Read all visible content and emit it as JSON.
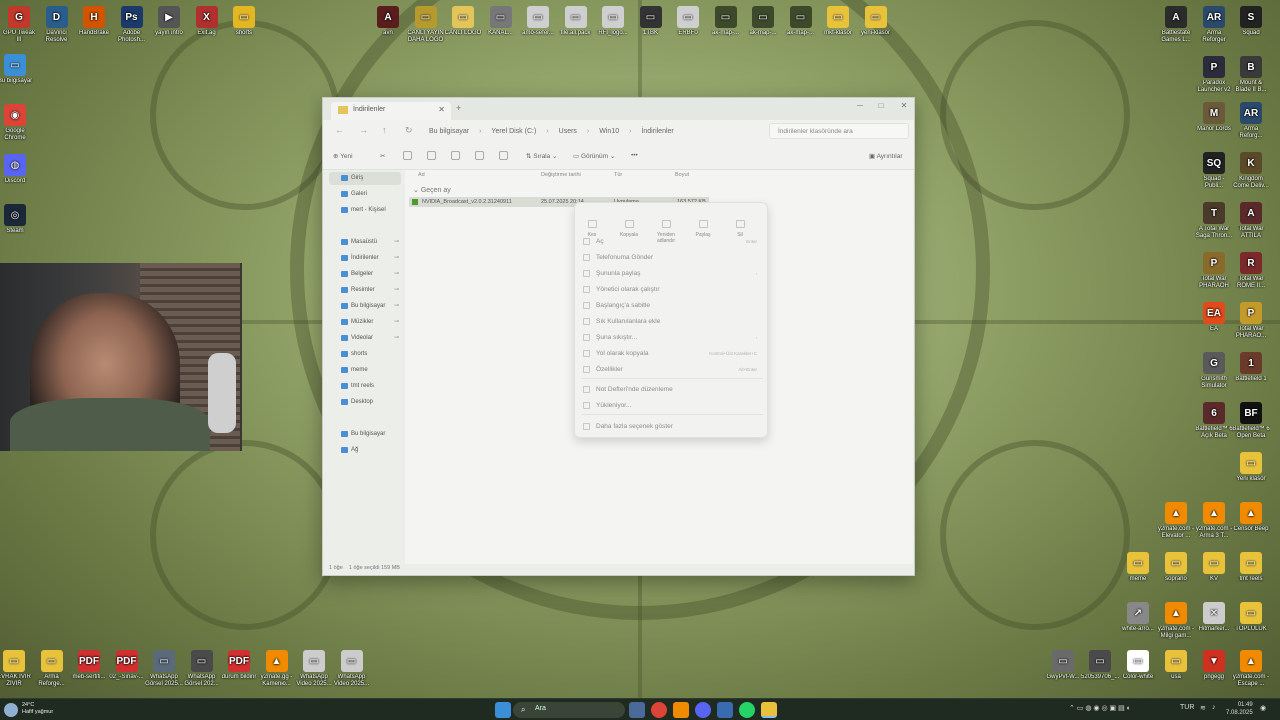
{
  "desktop": {
    "icons_top": [
      {
        "label": "GPU Tweak III",
        "color": "#c0392b",
        "glyph": "G"
      },
      {
        "label": "DaVinci Resolve",
        "color": "#2a5d8c",
        "glyph": "D"
      },
      {
        "label": "HandBrake",
        "color": "#d35400",
        "glyph": "H"
      },
      {
        "label": "Adobe Photosh...",
        "color": "#1b3a6b",
        "glyph": "Ps"
      },
      {
        "label": "yayın intro",
        "color": "#555555",
        "glyph": "▶"
      },
      {
        "label": "Exit.ag",
        "color": "#b03030",
        "glyph": "X"
      },
      {
        "label": "shorts",
        "color": "#e3b623",
        "glyph": "▭"
      }
    ],
    "icons_top_center": [
      {
        "label": "avn",
        "color": "#5a1d1d",
        "glyph": "A"
      },
      {
        "label": "CANLI YAYIN DAHA LOGO",
        "color": "#b59a2e",
        "glyph": "▭"
      },
      {
        "label": "CANLI LOGO",
        "color": "#e3c55a",
        "glyph": "▭"
      },
      {
        "label": "KANAL...",
        "color": "#777777",
        "glyph": "▭"
      },
      {
        "label": "amo-sefer...",
        "color": "#cfcfcf",
        "glyph": "▭"
      },
      {
        "label": "file.all.pack",
        "color": "#cfcfcf",
        "glyph": "▭"
      },
      {
        "label": "RFI_logo...",
        "color": "#cfcfcf",
        "glyph": "▭"
      },
      {
        "label": "1TBK",
        "color": "#333333",
        "glyph": "▭"
      },
      {
        "label": "ERBF0",
        "color": "#cfcfcf",
        "glyph": "▭"
      },
      {
        "label": "ak-map-...",
        "color": "#3c4a2b",
        "glyph": "▭"
      },
      {
        "label": "ak-map-...",
        "color": "#3c4a2b",
        "glyph": "▭"
      },
      {
        "label": "ak-map-...",
        "color": "#3c4a2b",
        "glyph": "▭"
      },
      {
        "label": "mkt-klasör",
        "color": "#e8c23a",
        "glyph": "▭"
      },
      {
        "label": "yeni-klasör",
        "color": "#e8c23a",
        "glyph": "▭"
      }
    ],
    "icons_left": [
      {
        "label": "Bu bilgisayar",
        "color": "#3a8fd6",
        "glyph": "▭"
      },
      {
        "label": "Google Chrome",
        "color": "#db4437",
        "glyph": "◉"
      },
      {
        "label": "Discord",
        "color": "#5865f2",
        "glyph": "◍"
      },
      {
        "label": "Steam",
        "color": "#1b2838",
        "glyph": "◎"
      }
    ],
    "icons_right": [
      {
        "label": "Battlestate Games L...",
        "color": "#2b2b2b",
        "glyph": "A"
      },
      {
        "label": "Arma Reforger",
        "color": "#2b4a6b",
        "glyph": "AR"
      },
      {
        "label": "Squad",
        "color": "#222222",
        "glyph": "S"
      },
      {
        "label": "Paradox Launcher v2",
        "color": "#2b2b3b",
        "glyph": "P"
      },
      {
        "label": "Mount & Blade II B...",
        "color": "#3a3a3a",
        "glyph": "B"
      },
      {
        "label": "Manor Lords",
        "color": "#6b5a3a",
        "glyph": "M"
      },
      {
        "label": "Arma Reforg...",
        "color": "#2b4a6b",
        "glyph": "AR"
      },
      {
        "label": "Squad - Publi...",
        "color": "#222222",
        "glyph": "SQ"
      },
      {
        "label": "Kingdom Come Deliv...",
        "color": "#5a4a2a",
        "glyph": "K"
      },
      {
        "label": "A Total War Saga Thron...",
        "color": "#4a3a2a",
        "glyph": "T"
      },
      {
        "label": "Total War ATTILA",
        "color": "#5a2a2a",
        "glyph": "A"
      },
      {
        "label": "Total War PHARAOH",
        "color": "#8a6a2a",
        "glyph": "P"
      },
      {
        "label": "Total War ROME II...",
        "color": "#7a2a2a",
        "glyph": "R"
      },
      {
        "label": "EA",
        "color": "#e24a1b",
        "glyph": "EA"
      },
      {
        "label": "Total War PHARAO...",
        "color": "#c49a2a",
        "glyph": "P"
      },
      {
        "label": "Gunsmith Simulator",
        "color": "#5a5a5a",
        "glyph": "G"
      },
      {
        "label": "Battlefield 1",
        "color": "#6a3a2a",
        "glyph": "1"
      },
      {
        "label": "Battlefield™ 6 Açık Beta",
        "color": "#5a2a2a",
        "glyph": "6"
      },
      {
        "label": "Battlefield™ 6 Open Beta",
        "color": "#111111",
        "glyph": "BF"
      },
      {
        "label": "Yeni klasör",
        "color": "#e8c23a",
        "glyph": "▭"
      },
      {
        "label": "y2mate.com - Elevator ...",
        "color": "#f08a00",
        "glyph": "▲"
      },
      {
        "label": "y2mate.com - Arma 3 T...",
        "color": "#f08a00",
        "glyph": "▲"
      },
      {
        "label": "Censor Beep",
        "color": "#f08a00",
        "glyph": "▲"
      },
      {
        "label": "meme",
        "color": "#e8c23a",
        "glyph": "▭"
      },
      {
        "label": "soprano",
        "color": "#e8c23a",
        "glyph": "▭"
      },
      {
        "label": "KV",
        "color": "#e8c23a",
        "glyph": "▭"
      },
      {
        "label": "tmt reels",
        "color": "#e8c23a",
        "glyph": "▭"
      },
      {
        "label": "white-arro...",
        "color": "#888888",
        "glyph": "↗"
      },
      {
        "label": "y2mate.com - Milgi gam...",
        "color": "#f08a00",
        "glyph": "▲"
      },
      {
        "label": "Hitmarker...",
        "color": "#cccccc",
        "glyph": "✕"
      },
      {
        "label": "TOPLULUK",
        "color": "#e8c23a",
        "glyph": "▭"
      },
      {
        "label": "GwyPvf-W...",
        "color": "#6a6a6a",
        "glyph": "▭"
      },
      {
        "label": "520539706_...",
        "color": "#4a4a4a",
        "glyph": "▭"
      },
      {
        "label": "Color-white",
        "color": "#ffffff",
        "glyph": "▭"
      },
      {
        "label": "usa",
        "color": "#e8c23a",
        "glyph": "▭"
      },
      {
        "label": "pngegg",
        "color": "#d03020",
        "glyph": "▼"
      },
      {
        "label": "y2mate.com - Escape ...",
        "color": "#f08a00",
        "glyph": "▲"
      }
    ],
    "icons_bottom": [
      {
        "label": "EVRAK IVIR ZIVIR",
        "color": "#e8c23a",
        "glyph": "▭"
      },
      {
        "label": "Arma Reforge...",
        "color": "#e8c23a",
        "glyph": "▭"
      },
      {
        "label": "meb-sertifi...",
        "color": "#d03030",
        "glyph": "PDF"
      },
      {
        "label": "02_-Sınav-...",
        "color": "#d03030",
        "glyph": "PDF"
      },
      {
        "label": "WhatsApp Görsel 2025...",
        "color": "#5a6a7a",
        "glyph": "▭"
      },
      {
        "label": "WhatsApp Görsel 202...",
        "color": "#4a4a4a",
        "glyph": "▭"
      },
      {
        "label": "durum bildirir",
        "color": "#d03030",
        "glyph": "PDF"
      },
      {
        "label": "y2mate.gg - Kamenю...",
        "color": "#f08a00",
        "glyph": "▲"
      },
      {
        "label": "WhatsApp Video 2025...",
        "color": "#cccccc",
        "glyph": "▭"
      },
      {
        "label": "WhatsApp Video 2025...",
        "color": "#cccccc",
        "glyph": "▭"
      }
    ]
  },
  "explorer": {
    "tab_title": "İndirilenler",
    "breadcrumbs": [
      "Bu bilgisayar",
      "Yerel Disk (C:)",
      "Users",
      "Win10",
      "İndirilenler"
    ],
    "search_placeholder": "İndirilenler klasöründe ara",
    "commands": {
      "new": "Yeni",
      "sort": "Sırala",
      "view": "Görünüm",
      "details": "Ayrıntılar"
    },
    "sidebar": [
      {
        "label": "Giriş",
        "pinned": false
      },
      {
        "label": "Galeri",
        "pinned": false
      },
      {
        "label": "mert - Kişisel",
        "pinned": false
      },
      {
        "label": "Masaüstü",
        "pinned": true
      },
      {
        "label": "İndirilenler",
        "pinned": true
      },
      {
        "label": "Belgeler",
        "pinned": true
      },
      {
        "label": "Resimler",
        "pinned": true
      },
      {
        "label": "Bu bilgisayar",
        "pinned": true
      },
      {
        "label": "Müzikler",
        "pinned": true
      },
      {
        "label": "Videolar",
        "pinned": true
      },
      {
        "label": "shorts",
        "pinned": false
      },
      {
        "label": "meme",
        "pinned": false
      },
      {
        "label": "tmt reels",
        "pinned": false
      },
      {
        "label": "Desktop",
        "pinned": false
      },
      {
        "label": "Bu bilgisayar",
        "pinned": false
      },
      {
        "label": "Ağ",
        "pinned": false
      }
    ],
    "columns": {
      "name": "Ad",
      "modified": "Değiştirme tarihi",
      "type": "Tür",
      "size": "Boyut"
    },
    "group_label": "Geçen ay",
    "file": {
      "name": "NVIDIA_Broadcast_v2.0.2.31240911",
      "modified": "25.07.2025 20:14",
      "type": "Uygulama",
      "size": "163.572 KB"
    },
    "status": {
      "count": "1 öğe",
      "selected": "1 öğe seçildi  159 MB"
    }
  },
  "context_menu": {
    "quick_actions": [
      "Kes",
      "Kopyala",
      "Yeniden adlandır",
      "Paylaş",
      "Sil"
    ],
    "items": [
      {
        "label": "Aç",
        "shortcut": "Enter"
      },
      {
        "label": "Telefonuma Gönder",
        "shortcut": ""
      },
      {
        "label": "Şununla paylaş",
        "shortcut": "›"
      },
      {
        "label": "Yönetici olarak çalıştır",
        "shortcut": ""
      },
      {
        "label": "Başlangıç'a sabitle",
        "shortcut": ""
      },
      {
        "label": "Sık Kullanılanlara ekle",
        "shortcut": ""
      },
      {
        "label": "Şuna sıkıştır...",
        "shortcut": "›"
      },
      {
        "label": "Yol olarak kopyala",
        "shortcut": "Kontrol+Üst Karakter+C"
      },
      {
        "label": "Özellikler",
        "shortcut": "Alt+Enter"
      },
      {
        "label": "Not Defteri'nde düzenleme",
        "shortcut": ""
      },
      {
        "label": "Yükleniyor...",
        "shortcut": ""
      },
      {
        "label": "Daha fazla seçenek göster",
        "shortcut": ""
      }
    ]
  },
  "taskbar": {
    "weather_temp": "24°C",
    "weather_desc": "Hafif yağmur",
    "search_placeholder": "Ara",
    "lang": "TUR",
    "time": "01:49",
    "date": "7.08.2025"
  }
}
